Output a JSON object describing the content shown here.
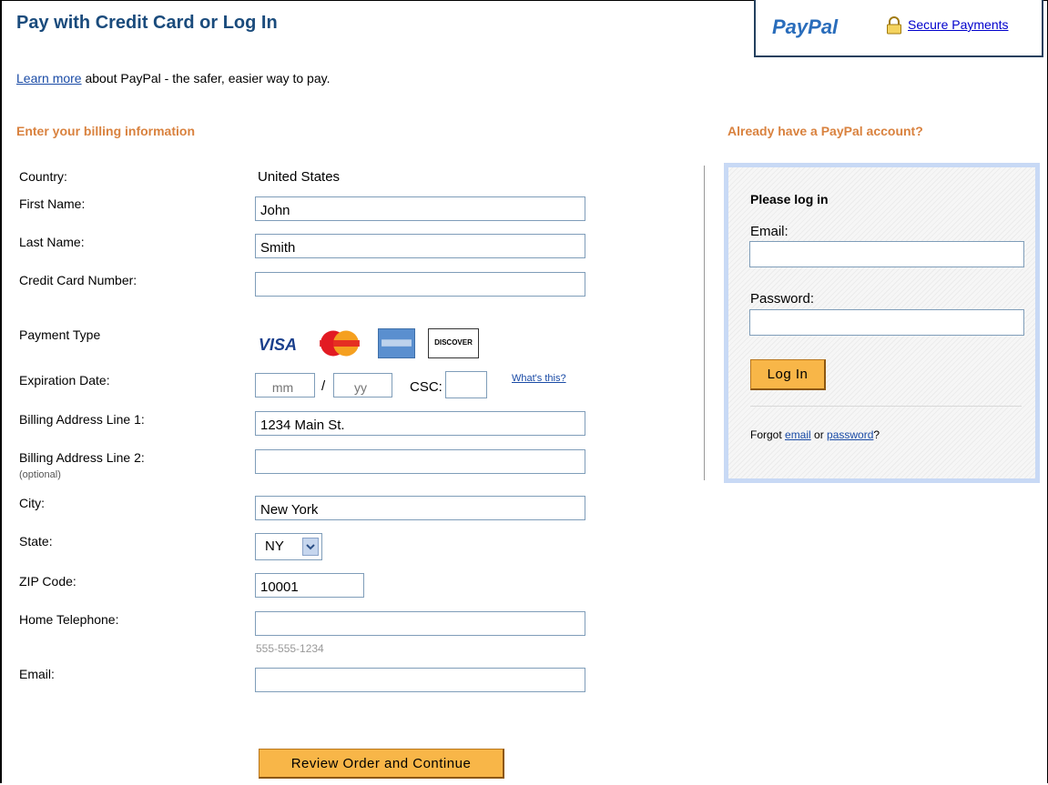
{
  "header": {
    "title": "Pay with Credit Card or Log In",
    "brand": "PayPal",
    "brand_colors": {
      "dark": "#1b3c78",
      "light": "#2a6dbb"
    },
    "secure_link": "Secure Payments"
  },
  "intro": {
    "learn_more_link": "Learn more",
    "text": " about PayPal - the safer, easier way to pay."
  },
  "billing": {
    "heading": "Enter your billing information",
    "country_label": "Country:",
    "country_value": "United States",
    "first_name_label": "First Name:",
    "first_name_value": "John",
    "last_name_label": "Last Name:",
    "last_name_value": "Smith",
    "card_number_label": "Credit Card Number:",
    "card_number_value": "",
    "payment_type_label": "Payment Type",
    "cards": {
      "visa": "VISA",
      "mastercard": "MasterCard",
      "amex": "American Express",
      "discover": "DISCOVER"
    },
    "expiration_label": "Expiration Date:",
    "exp_month_placeholder": "mm",
    "exp_separator": "/",
    "exp_year_placeholder": "yy",
    "csc_label": "CSC:",
    "csc_value": "",
    "whats_this_link": "What's this?",
    "address1_label": "Billing Address Line 1:",
    "address1_value": "1234 Main St.",
    "address2_label": "Billing Address Line 2:",
    "address2_sub": "(optional)",
    "address2_value": "",
    "city_label": "City:",
    "city_value": "New York",
    "state_label": "State:",
    "state_value": "NY",
    "zip_label": "ZIP Code:",
    "zip_value": "10001",
    "phone_label": "Home Telephone:",
    "phone_value": "",
    "phone_hint": "555-555-1234",
    "email_label": "Email:",
    "email_value": "",
    "submit_button": "Review Order and Continue"
  },
  "login": {
    "heading": "Already have a PayPal account?",
    "title": "Please log in",
    "email_label": "Email:",
    "email_value": "",
    "password_label": "Password:",
    "password_value": "",
    "login_button": "Log In",
    "forgot_prefix": "Forgot ",
    "forgot_email_link": "email",
    "forgot_or": " or ",
    "forgot_password_link": "password",
    "forgot_suffix": "?"
  },
  "icons": {
    "lock": "lock-icon",
    "state_dropdown": "chevron-down-icon"
  },
  "accent_colors": {
    "heading": "#d9823f",
    "title": "#1a4b7c",
    "button": "#f8b648",
    "login_border": "#c8d9f5"
  }
}
